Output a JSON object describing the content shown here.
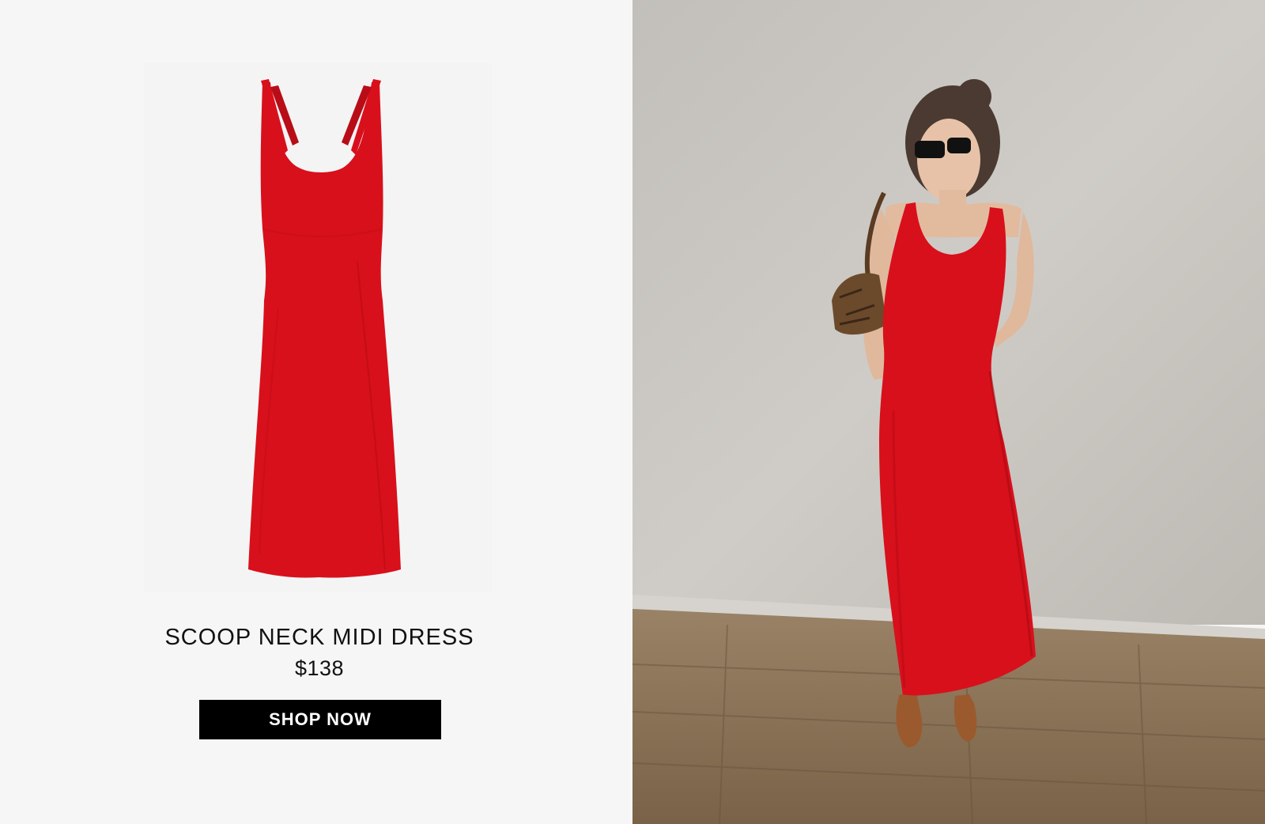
{
  "product": {
    "title": "SCOOP NECK MIDI DRESS",
    "price": "$138",
    "cta_label": "SHOP NOW"
  },
  "colors": {
    "dress": "#d8101b",
    "panel_bg": "#f6f6f6",
    "button_bg": "#000000",
    "button_text": "#ffffff",
    "wall": "#c9c6c1",
    "floor": "#8a7258"
  },
  "images": {
    "product_shot": "red-scoop-neck-dress",
    "lifestyle_shot": "woman-wearing-red-dress"
  }
}
